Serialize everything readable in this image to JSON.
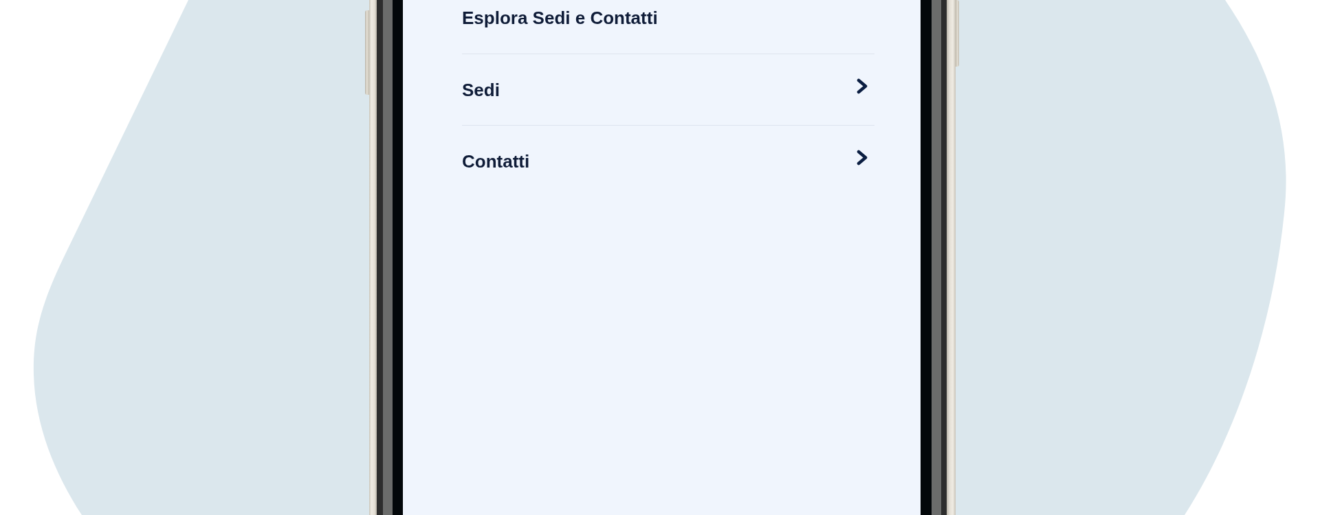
{
  "screen": {
    "heading": "Esplora Sedi e Contatti",
    "items": [
      {
        "label": "Sedi"
      },
      {
        "label": "Contatti"
      }
    ]
  }
}
